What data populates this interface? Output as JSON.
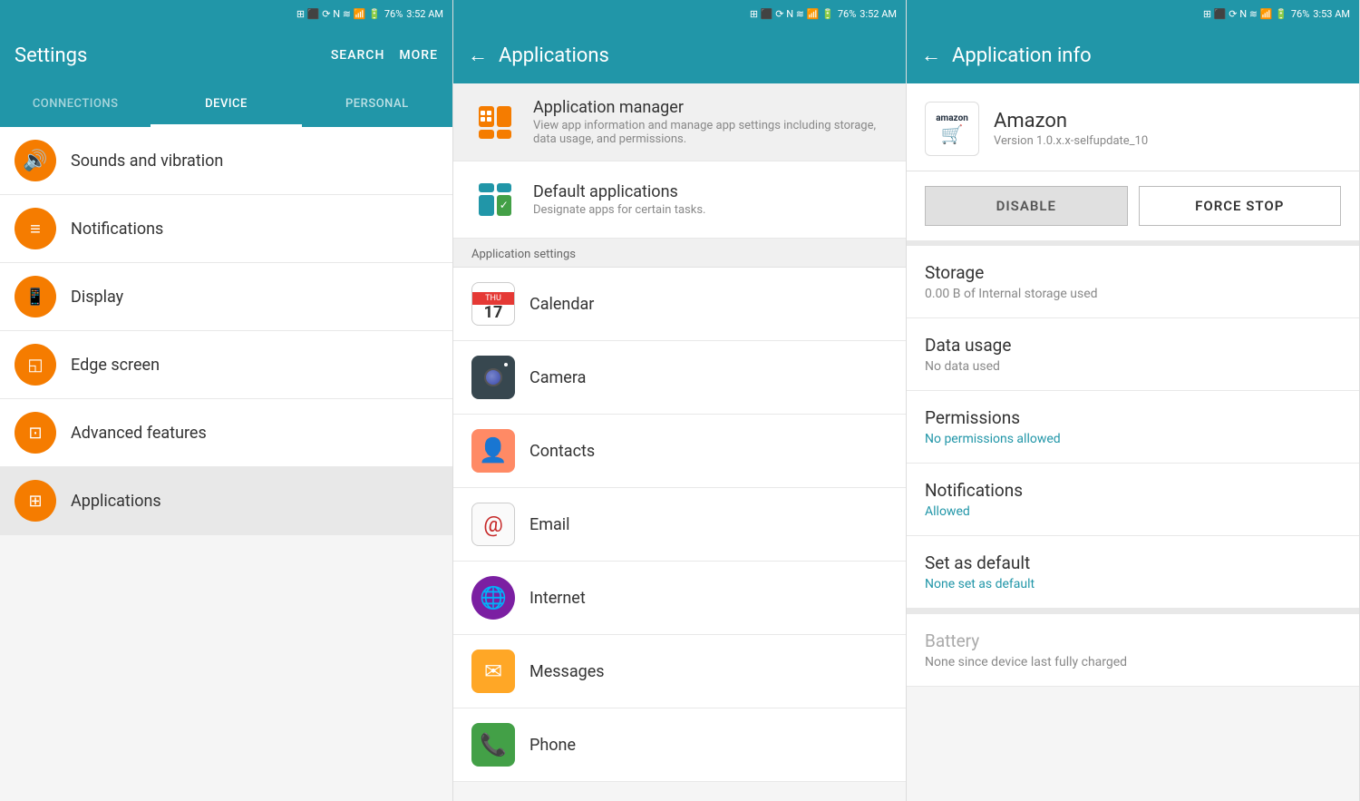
{
  "panels": {
    "settings": {
      "statusBar": {
        "time": "3:52 AM",
        "battery": "76%"
      },
      "title": "Settings",
      "actions": [
        "SEARCH",
        "MORE"
      ],
      "tabs": [
        {
          "label": "CONNECTIONS",
          "active": false
        },
        {
          "label": "DEVICE",
          "active": true
        },
        {
          "label": "PERSONAL",
          "active": false
        }
      ],
      "items": [
        {
          "icon": "volume-icon",
          "label": "Sounds and vibration"
        },
        {
          "icon": "notification-icon",
          "label": "Notifications"
        },
        {
          "icon": "display-icon",
          "label": "Display"
        },
        {
          "icon": "edge-icon",
          "label": "Edge screen"
        },
        {
          "icon": "advanced-icon",
          "label": "Advanced features"
        },
        {
          "icon": "apps-icon",
          "label": "Applications",
          "selected": true
        }
      ]
    },
    "applications": {
      "statusBar": {
        "time": "3:52 AM",
        "battery": "76%"
      },
      "title": "Applications",
      "managerSection": {
        "title": "Application manager",
        "desc": "View app information and manage app settings including storage, data usage, and permissions."
      },
      "defaultSection": {
        "title": "Default applications",
        "desc": "Designate apps for certain tasks."
      },
      "sectionHeader": "Application settings",
      "appList": [
        {
          "name": "Calendar",
          "type": "calendar"
        },
        {
          "name": "Camera",
          "type": "camera"
        },
        {
          "name": "Contacts",
          "type": "contacts"
        },
        {
          "name": "Email",
          "type": "email"
        },
        {
          "name": "Internet",
          "type": "internet"
        },
        {
          "name": "Messages",
          "type": "messages"
        },
        {
          "name": "Phone",
          "type": "phone"
        }
      ]
    },
    "appInfo": {
      "statusBar": {
        "time": "3:53 AM",
        "battery": "76%"
      },
      "title": "Application info",
      "app": {
        "name": "Amazon",
        "version": "Version 1.0.x.x-selfupdate_10"
      },
      "buttons": {
        "disable": "DISABLE",
        "forceStop": "FORCE STOP"
      },
      "sections": [
        {
          "title": "Storage",
          "value": "0.00 B of Internal storage used",
          "isLink": false
        },
        {
          "title": "Data usage",
          "value": "No data used",
          "isLink": false
        },
        {
          "title": "Permissions",
          "value": "No permissions allowed",
          "isLink": true
        },
        {
          "title": "Notifications",
          "value": "Allowed",
          "isLink": true
        },
        {
          "title": "Set as default",
          "value": "None set as default",
          "isLink": true
        },
        {
          "title": "Battery",
          "value": "None since device last fully charged",
          "isLink": false,
          "dimmed": true
        }
      ]
    }
  }
}
